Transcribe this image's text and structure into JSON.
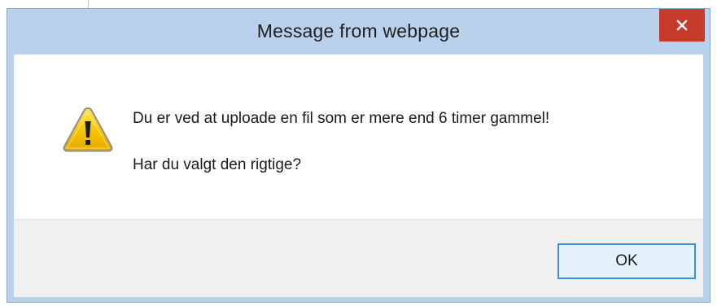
{
  "dialog": {
    "title": "Message from webpage",
    "close_icon": "close-icon",
    "warning_icon": "warning-icon",
    "message_line1": "Du er ved at uploade en fil som er mere end 6 timer gammel!",
    "message_line2": "Har du valgt den rigtige?",
    "ok_label": "OK"
  },
  "colors": {
    "frame": "#b9d1ea",
    "close_button": "#c7392b",
    "footer": "#f0f0f0",
    "button_border": "#3c8fdc",
    "button_fill": "#e5f1fb",
    "warning_yellow": "#f5c400"
  }
}
